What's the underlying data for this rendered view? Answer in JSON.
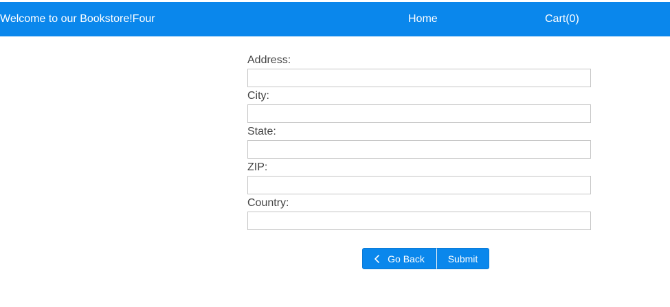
{
  "header": {
    "brand": "Welcome to our Bookstore!Four",
    "nav": {
      "home": "Home",
      "cart": "Cart(0)"
    }
  },
  "form": {
    "fields": [
      {
        "label": "Address:",
        "value": "",
        "placeholder": ""
      },
      {
        "label": "City:",
        "value": "",
        "placeholder": ""
      },
      {
        "label": "State:",
        "value": "",
        "placeholder": ""
      },
      {
        "label": "ZIP:",
        "value": "",
        "placeholder": ""
      },
      {
        "label": "Country:",
        "value": "",
        "placeholder": ""
      }
    ]
  },
  "actions": {
    "back_label": "Go Back",
    "back_icon": "chevron-left-icon",
    "submit_label": "Submit"
  },
  "colors": {
    "accent": "#0a87ec",
    "text": "#444444",
    "input_border": "#c4c4c4"
  }
}
